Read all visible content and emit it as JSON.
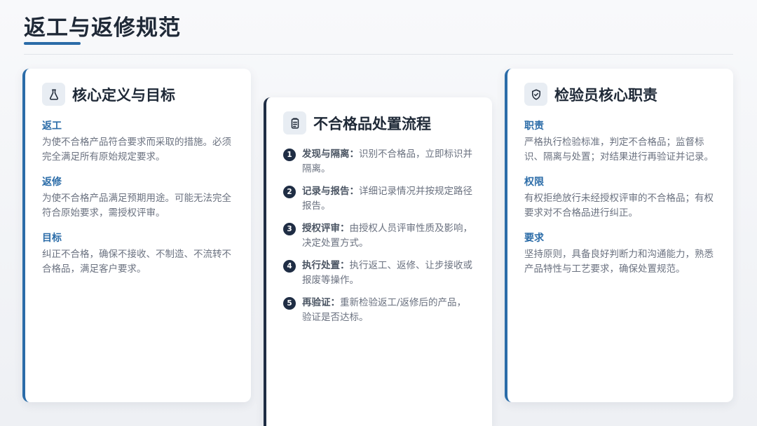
{
  "page": {
    "title": "返工与返修规范"
  },
  "card_definition": {
    "title": "核心定义与目标",
    "icon": "flask-icon",
    "sections": [
      {
        "label": "返工",
        "text": "为使不合格产品符合要求而采取的措施。必须完全满足所有原始规定要求。"
      },
      {
        "label": "返修",
        "text": "为使不合格产品满足预期用途。可能无法完全符合原始要求，需授权评审。"
      },
      {
        "label": "目标",
        "text": "纠正不合格，确保不接收、不制造、不流转不合格品，满足客户要求。"
      }
    ]
  },
  "card_process": {
    "title": "不合格品处置流程",
    "icon": "clipboard-icon",
    "steps": [
      {
        "num": "1",
        "label": "发现与隔离：",
        "text": "识别不合格品，立即标识并隔离。"
      },
      {
        "num": "2",
        "label": "记录与报告：",
        "text": "详细记录情况并按规定路径报告。"
      },
      {
        "num": "3",
        "label": "授权评审：",
        "text": "由授权人员评审性质及影响，决定处置方式。"
      },
      {
        "num": "4",
        "label": "执行处置：",
        "text": "执行返工、返修、让步接收或报废等操作。"
      },
      {
        "num": "5",
        "label": "再验证：",
        "text": "重新检验返工/返修后的产品，验证是否达标。"
      }
    ]
  },
  "card_inspector": {
    "title": "检验员核心职责",
    "icon": "shield-check-icon",
    "sections": [
      {
        "label": "职责",
        "text": "严格执行检验标准，判定不合格品；监督标识、隔离与处置；对结果进行再验证并记录。"
      },
      {
        "label": "权限",
        "text": "有权拒绝放行未经授权评审的不合格品；有权要求对不合格品进行纠正。"
      },
      {
        "label": "要求",
        "text": "坚持原则，具备良好判断力和沟通能力，熟悉产品特性与工艺要求，确保处置规范。"
      }
    ]
  },
  "colors": {
    "accent": "#2b6ca8",
    "dark": "#1f2d44"
  }
}
